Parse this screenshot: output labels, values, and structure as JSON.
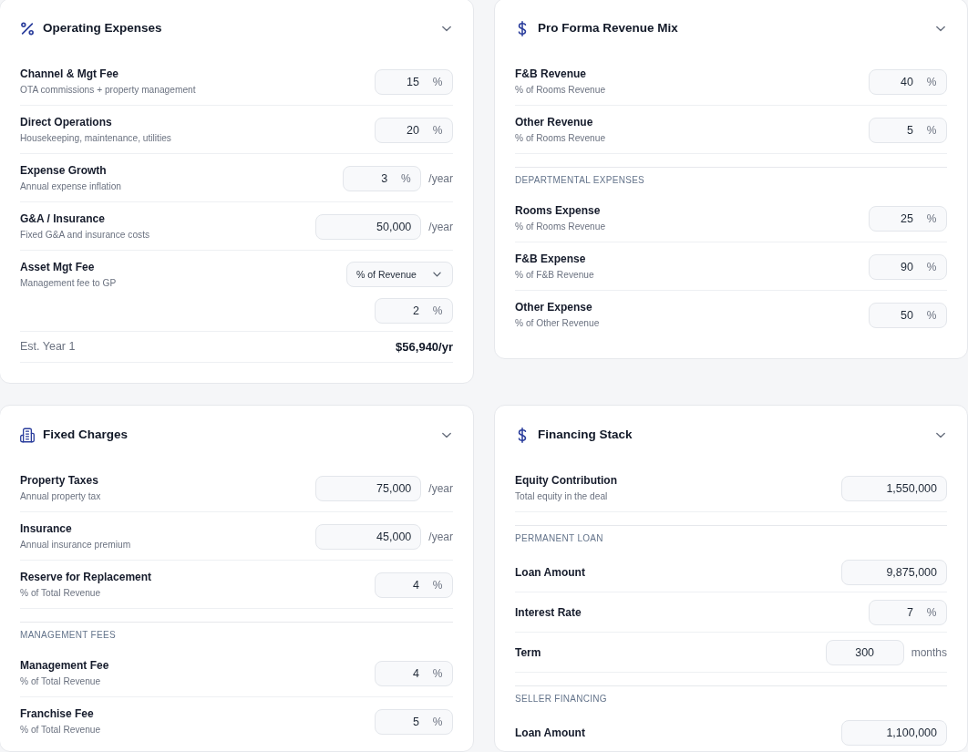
{
  "panels": [
    {
      "title": "Operating Expenses",
      "kind": "expenses",
      "rows": [
        {
          "kind": "percent",
          "label": "Channel & Mgt Fee",
          "hint": "OTA commissions + property management",
          "value": "15",
          "unit": "%"
        },
        {
          "kind": "percent",
          "label": "Direct Operations",
          "hint": "Housekeeping, maintenance, utilities",
          "value": "20",
          "unit": "%"
        },
        {
          "kind": "percent",
          "label": "Expense Growth",
          "hint": "Annual expense inflation",
          "value": "3",
          "unit": "%",
          "suffix": "/year"
        },
        {
          "kind": "amount",
          "label": "G&A / Insurance",
          "hint": "Fixed G&A and insurance costs",
          "value": "50,000",
          "suffix": "/year"
        },
        {
          "kind": "choice",
          "label": "Asset Mgt Fee",
          "hint": "Management fee to GP",
          "option": "% of Revenue",
          "value": "2",
          "unit": "%"
        },
        {
          "kind": "total",
          "label": "Est. Year 1",
          "value": "$56,940/yr"
        }
      ]
    },
    {
      "title": "Pro Forma Revenue Mix",
      "kind": "revenue",
      "rows": [
        {
          "kind": "percent",
          "label": "F&B Revenue",
          "hint": "% of Rooms Revenue",
          "value": "40",
          "unit": "%"
        },
        {
          "kind": "percent",
          "label": "Other Revenue",
          "hint": "% of Rooms Revenue",
          "value": "5",
          "unit": "%"
        },
        {
          "kind": "section",
          "label": "DEPARTMENTAL EXPENSES"
        },
        {
          "kind": "percent",
          "label": "Rooms Expense",
          "hint": "% of Rooms Revenue",
          "value": "25",
          "unit": "%"
        },
        {
          "kind": "percent",
          "label": "F&B Expense",
          "hint": "% of F&B Revenue",
          "value": "90",
          "unit": "%"
        },
        {
          "kind": "percent",
          "label": "Other Expense",
          "hint": "% of Other Revenue",
          "value": "50",
          "unit": "%"
        }
      ]
    },
    {
      "title": "Fixed Charges",
      "kind": "charges",
      "rows": [
        {
          "kind": "amount",
          "label": "Property Taxes",
          "hint": "Annual property tax",
          "value": "75,000",
          "suffix": "/year"
        },
        {
          "kind": "amount",
          "label": "Insurance",
          "hint": "Annual insurance premium",
          "value": "45,000",
          "suffix": "/year"
        },
        {
          "kind": "percent",
          "label": "Reserve for Replacement",
          "hint": "% of Total Revenue",
          "value": "4",
          "unit": "%"
        },
        {
          "kind": "section",
          "label": "MANAGEMENT FEES"
        },
        {
          "kind": "percent",
          "label": "Management Fee",
          "hint": "% of Total Revenue",
          "value": "4",
          "unit": "%"
        },
        {
          "kind": "percent",
          "label": "Franchise Fee",
          "hint": "% of Total Revenue",
          "value": "5",
          "unit": "%"
        }
      ]
    },
    {
      "title": "Financing Stack",
      "kind": "financing",
      "rows": [
        {
          "kind": "amount",
          "label": "Equity Contribution",
          "hint": "Total equity in the deal",
          "value": "1,550,000"
        },
        {
          "kind": "section",
          "label": "PERMANENT LOAN"
        },
        {
          "kind": "amount",
          "label": "Loan Amount",
          "value": "9,875,000"
        },
        {
          "kind": "percent",
          "label": "Interest Rate",
          "value": "7",
          "unit": "%"
        },
        {
          "kind": "count",
          "label": "Term",
          "value": "300",
          "suffix": "months"
        },
        {
          "kind": "section",
          "label": "SELLER FINANCING"
        },
        {
          "kind": "amount",
          "label": "Loan Amount",
          "value": "1,100,000"
        }
      ]
    }
  ]
}
